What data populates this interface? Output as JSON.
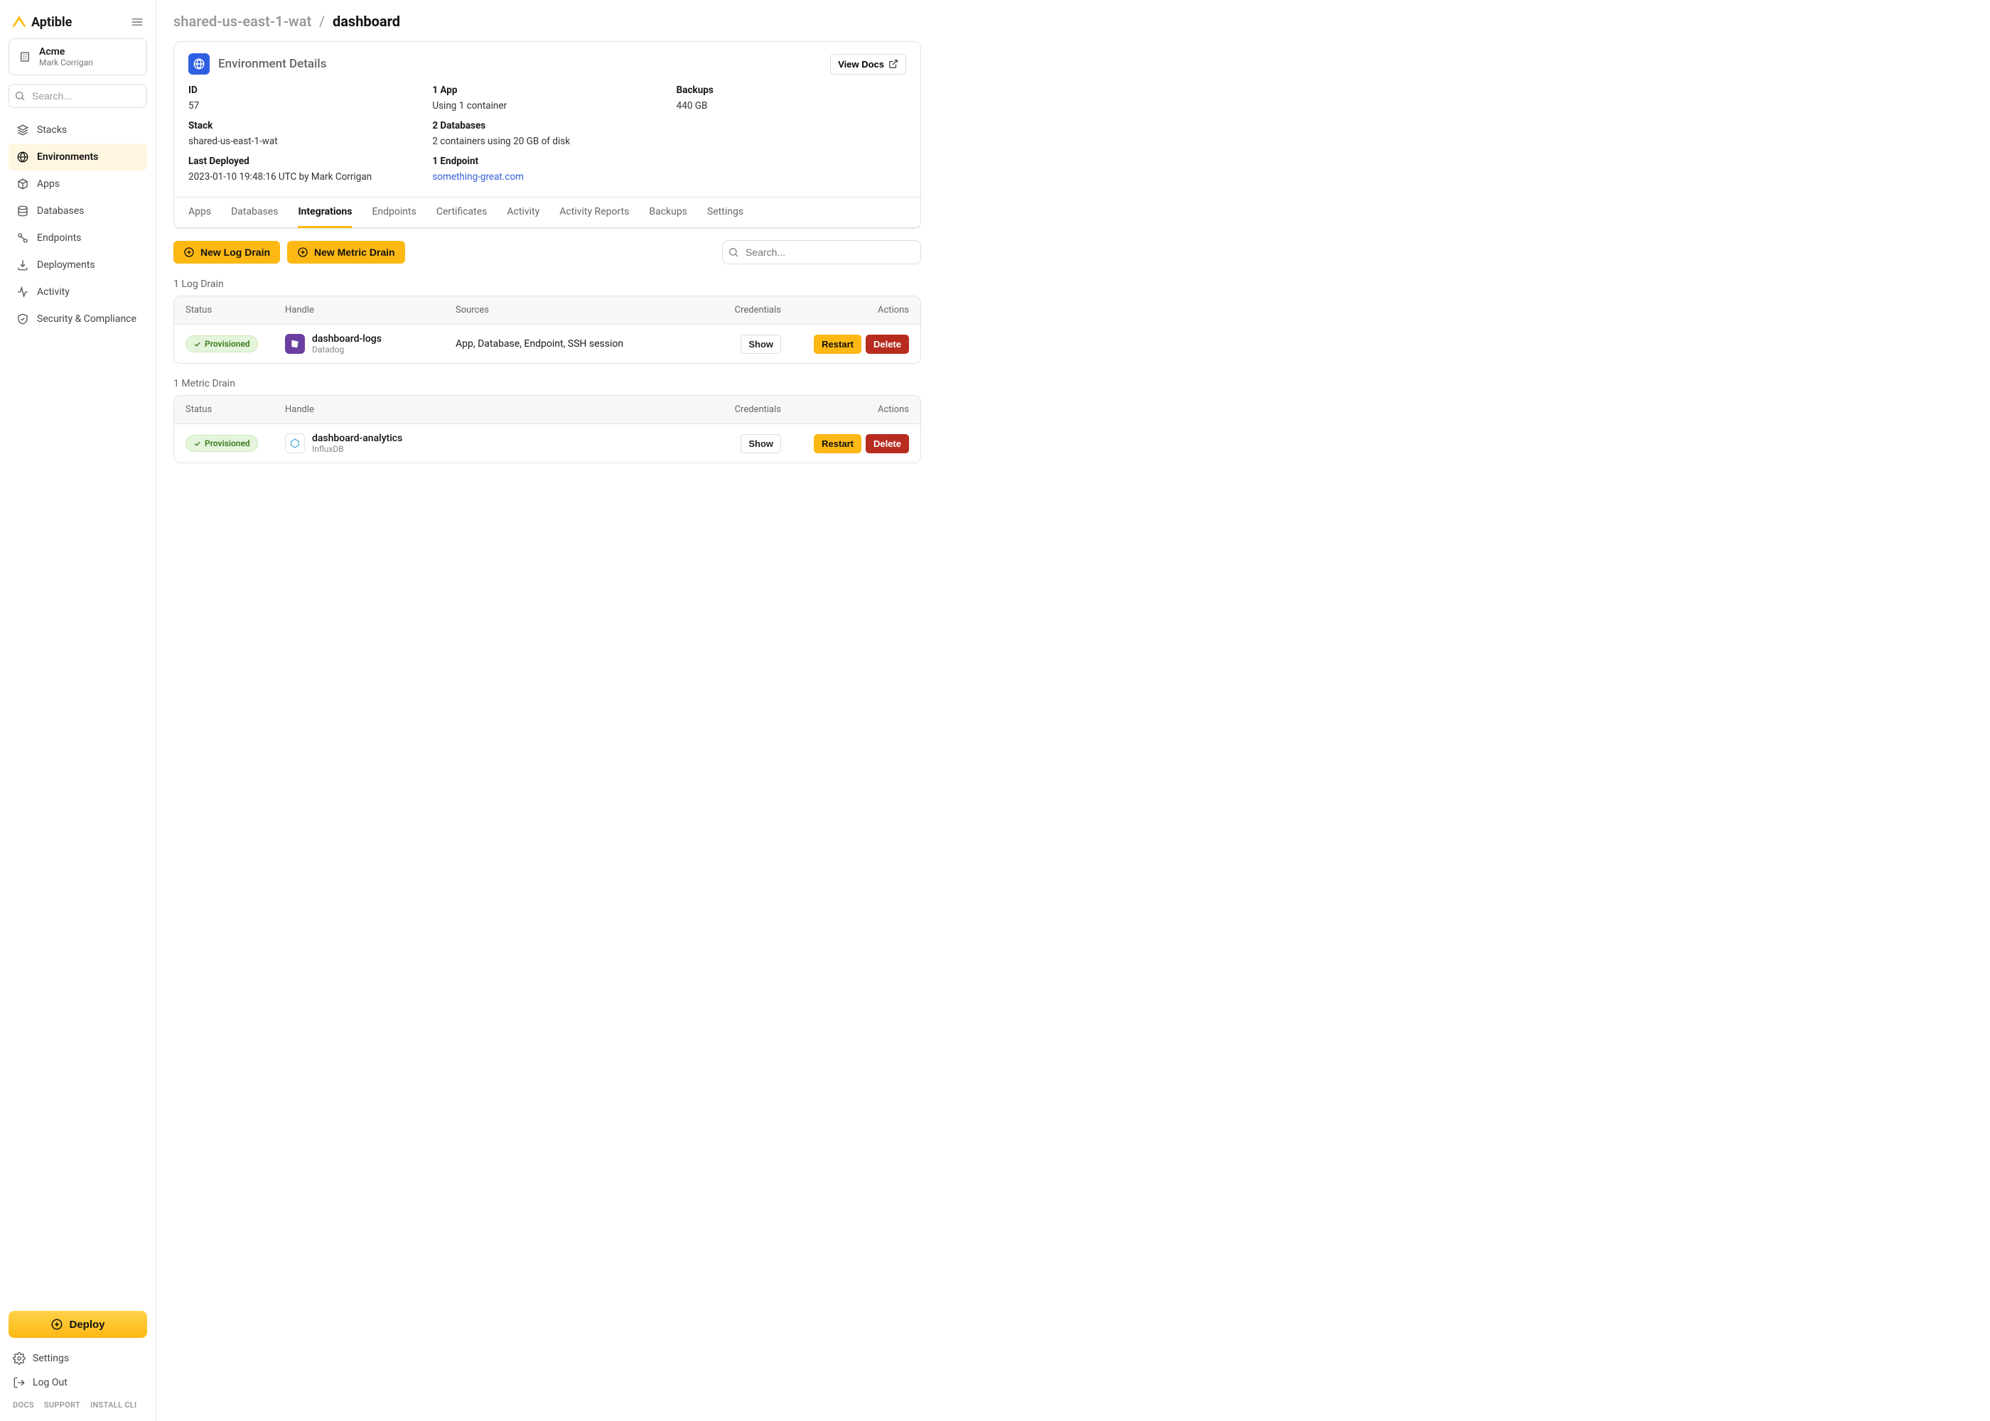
{
  "brand": {
    "name": "Aptible"
  },
  "org": {
    "name": "Acme",
    "user": "Mark Corrigan"
  },
  "sidebar": {
    "search_placeholder": "Search...",
    "items": [
      {
        "name": "stacks",
        "label": "Stacks"
      },
      {
        "name": "environments",
        "label": "Environments",
        "active": true
      },
      {
        "name": "apps",
        "label": "Apps"
      },
      {
        "name": "databases",
        "label": "Databases"
      },
      {
        "name": "endpoints",
        "label": "Endpoints"
      },
      {
        "name": "deployments",
        "label": "Deployments"
      },
      {
        "name": "activity",
        "label": "Activity"
      },
      {
        "name": "security",
        "label": "Security & Compliance"
      }
    ],
    "deploy_label": "Deploy",
    "settings_label": "Settings",
    "logout_label": "Log Out",
    "footer": {
      "docs": "DOCS",
      "support": "SUPPORT",
      "cli": "INSTALL CLI"
    }
  },
  "breadcrumb": {
    "parent": "shared-us-east-1-wat",
    "sep": "/",
    "current": "dashboard"
  },
  "card": {
    "title": "Environment Details",
    "view_docs": "View Docs",
    "details": [
      {
        "label": "ID",
        "value": "57"
      },
      {
        "label": "1 App",
        "value": "Using 1 container"
      },
      {
        "label": "Backups",
        "value": "440 GB"
      },
      {
        "label": "Stack",
        "value": "shared-us-east-1-wat"
      },
      {
        "label": "2 Databases",
        "value": "2 containers using 20 GB of disk"
      },
      {
        "label": "",
        "value": ""
      },
      {
        "label": "Last Deployed",
        "value": "2023-01-10 19:48:16 UTC by Mark Corrigan"
      },
      {
        "label": "1 Endpoint",
        "value": "something-great.com",
        "link": true
      }
    ]
  },
  "tabs": [
    {
      "label": "Apps"
    },
    {
      "label": "Databases"
    },
    {
      "label": "Integrations",
      "active": true
    },
    {
      "label": "Endpoints"
    },
    {
      "label": "Certificates"
    },
    {
      "label": "Activity"
    },
    {
      "label": "Activity Reports"
    },
    {
      "label": "Backups"
    },
    {
      "label": "Settings"
    }
  ],
  "actions": {
    "new_log_drain": "New Log Drain",
    "new_metric_drain": "New Metric Drain",
    "search_placeholder": "Search..."
  },
  "log_section": {
    "heading": "1 Log Drain",
    "columns": {
      "status": "Status",
      "handle": "Handle",
      "sources": "Sources",
      "credentials": "Credentials",
      "actions": "Actions"
    },
    "rows": [
      {
        "status": "Provisioned",
        "provider_icon": "datadog",
        "handle": "dashboard-logs",
        "provider": "Datadog",
        "sources": "App, Database, Endpoint, SSH session",
        "show": "Show",
        "restart": "Restart",
        "delete": "Delete"
      }
    ]
  },
  "metric_section": {
    "heading": "1 Metric Drain",
    "columns": {
      "status": "Status",
      "handle": "Handle",
      "credentials": "Credentials",
      "actions": "Actions"
    },
    "rows": [
      {
        "status": "Provisioned",
        "provider_icon": "influx",
        "handle": "dashboard-analytics",
        "provider": "InfluxDB",
        "show": "Show",
        "restart": "Restart",
        "delete": "Delete"
      }
    ]
  }
}
